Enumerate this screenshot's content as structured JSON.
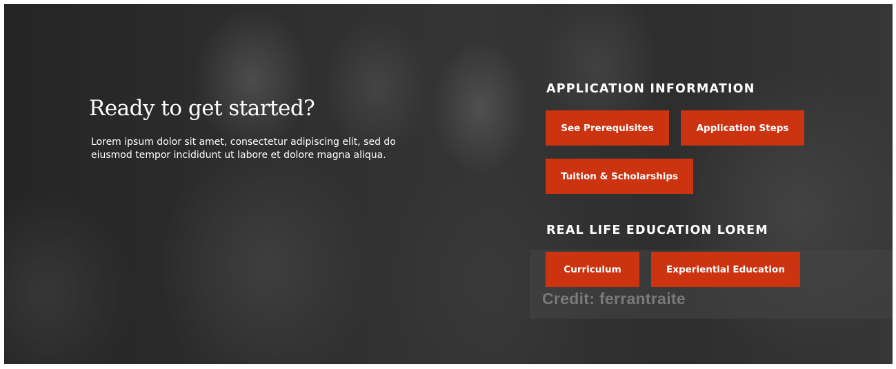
{
  "intro": {
    "title": "Ready to get started?",
    "body_line1": "Lorem ipsum dolor sit amet, consectetur adipiscing elit, sed do",
    "body_line2": "eiusmod tempor incididunt ut labore et dolore magna aliqua."
  },
  "application_info": {
    "heading": "APPLICATION INFORMATION",
    "buttons": [
      "See Prerequisites",
      "Application Steps",
      "Tuition & Scholarships"
    ]
  },
  "real_life_education": {
    "heading": "REAL LIFE EDUCATION LOREM",
    "buttons": [
      "Curriculum",
      "Experiential Education"
    ]
  },
  "photo_credit": "Credit: ferrantraite",
  "colors": {
    "accent": "#cc3311",
    "text": "#ffffff"
  }
}
